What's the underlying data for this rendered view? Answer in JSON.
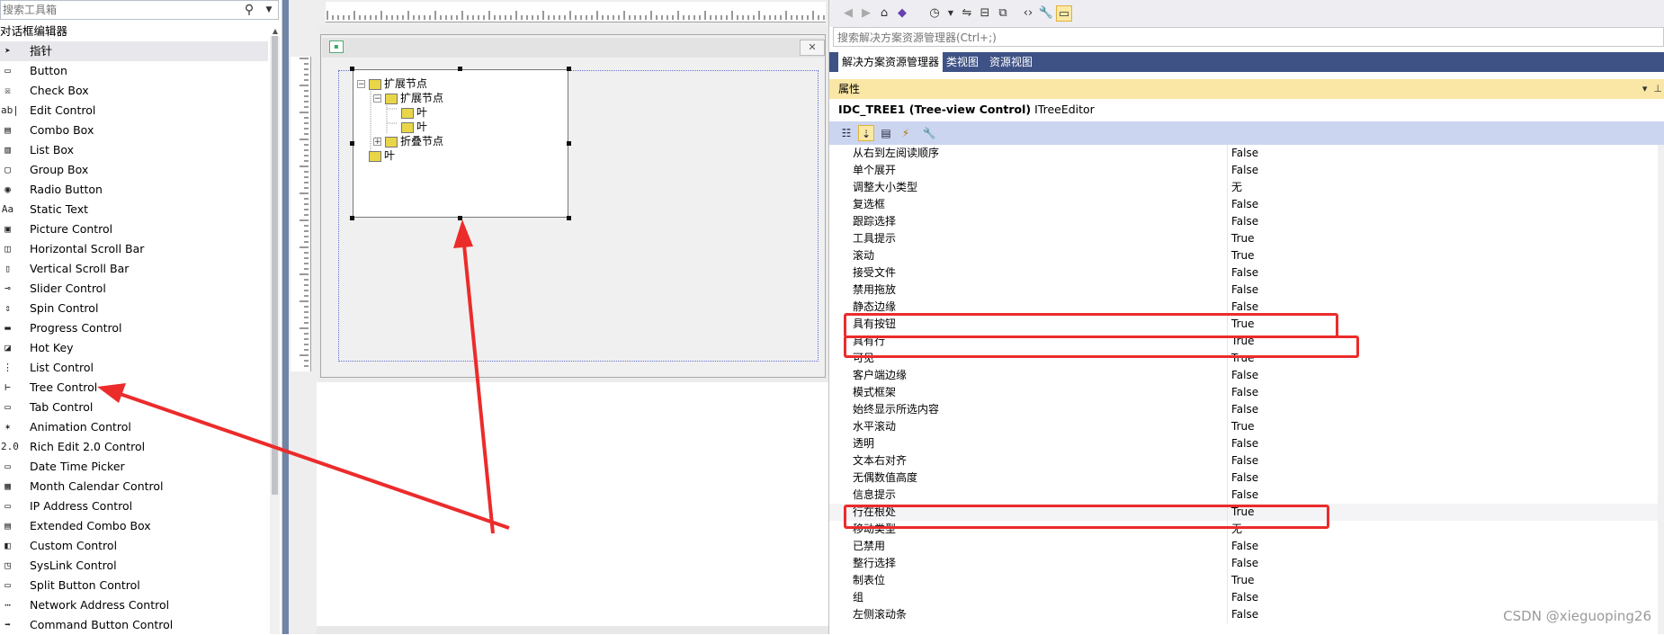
{
  "toolbox": {
    "search_placeholder": "搜索工具箱",
    "group_title": "对话框编辑器",
    "items": [
      {
        "label": "指针",
        "icon": "pointer-icon",
        "glyph": "➤",
        "selected": true
      },
      {
        "label": "Button",
        "icon": "button-icon",
        "glyph": "▭"
      },
      {
        "label": "Check Box",
        "icon": "checkbox-icon",
        "glyph": "☒"
      },
      {
        "label": "Edit Control",
        "icon": "edit-control-icon",
        "glyph": "ab|"
      },
      {
        "label": "Combo Box",
        "icon": "combo-box-icon",
        "glyph": "▤"
      },
      {
        "label": "List Box",
        "icon": "list-box-icon",
        "glyph": "▥"
      },
      {
        "label": "Group Box",
        "icon": "group-box-icon",
        "glyph": "▢"
      },
      {
        "label": "Radio Button",
        "icon": "radio-button-icon",
        "glyph": "◉"
      },
      {
        "label": "Static Text",
        "icon": "static-text-icon",
        "glyph": "Aa"
      },
      {
        "label": "Picture Control",
        "icon": "picture-control-icon",
        "glyph": "▣"
      },
      {
        "label": "Horizontal Scroll Bar",
        "icon": "hscroll-icon",
        "glyph": "◫"
      },
      {
        "label": "Vertical Scroll Bar",
        "icon": "vscroll-icon",
        "glyph": "▯"
      },
      {
        "label": "Slider Control",
        "icon": "slider-icon",
        "glyph": "⊸"
      },
      {
        "label": "Spin Control",
        "icon": "spin-control-icon",
        "glyph": "⇕"
      },
      {
        "label": "Progress Control",
        "icon": "progress-icon",
        "glyph": "▬"
      },
      {
        "label": "Hot Key",
        "icon": "hot-key-icon",
        "glyph": "◪"
      },
      {
        "label": "List Control",
        "icon": "list-control-icon",
        "glyph": "⋮"
      },
      {
        "label": "Tree Control",
        "icon": "tree-control-icon",
        "glyph": "⊢"
      },
      {
        "label": "Tab Control",
        "icon": "tab-control-icon",
        "glyph": "▭"
      },
      {
        "label": "Animation Control",
        "icon": "animation-icon",
        "glyph": "✶"
      },
      {
        "label": "Rich Edit 2.0 Control",
        "icon": "rich-edit-icon",
        "glyph": "2.0"
      },
      {
        "label": "Date Time Picker",
        "icon": "date-time-icon",
        "glyph": "▭"
      },
      {
        "label": "Month Calendar Control",
        "icon": "calendar-icon",
        "glyph": "▦"
      },
      {
        "label": "IP Address Control",
        "icon": "ip-address-icon",
        "glyph": "▭"
      },
      {
        "label": "Extended Combo Box",
        "icon": "ext-combo-icon",
        "glyph": "▤"
      },
      {
        "label": "Custom Control",
        "icon": "custom-control-icon",
        "glyph": "◧"
      },
      {
        "label": "SysLink Control",
        "icon": "syslink-icon",
        "glyph": "◳"
      },
      {
        "label": "Split Button Control",
        "icon": "split-button-icon",
        "glyph": "▭"
      },
      {
        "label": "Network Address Control",
        "icon": "network-address-icon",
        "glyph": "⋯"
      },
      {
        "label": "Command Button Control",
        "icon": "command-button-icon",
        "glyph": "➡"
      }
    ]
  },
  "tree_preview": {
    "nodes": [
      {
        "label": "扩展节点",
        "level": 0,
        "expander": "−"
      },
      {
        "label": "扩展节点",
        "level": 1,
        "expander": "−"
      },
      {
        "label": "叶",
        "level": 2,
        "expander": ""
      },
      {
        "label": "叶",
        "level": 2,
        "expander": ""
      },
      {
        "label": "折叠节点",
        "level": 1,
        "expander": "+"
      },
      {
        "label": "叶",
        "level": 0,
        "expander": ""
      }
    ]
  },
  "solution": {
    "search_placeholder": "搜索解决方案资源管理器(Ctrl+;)",
    "tabs": [
      "解决方案资源管理器",
      "类视图",
      "资源视图"
    ],
    "active_tab": 0
  },
  "properties": {
    "title": "属性",
    "object_id": "IDC_TREE1 (Tree-view Control)",
    "object_type": "ITreeEditor",
    "rows": [
      {
        "name": "从右到左阅读顺序",
        "value": "False"
      },
      {
        "name": "单个展开",
        "value": "False"
      },
      {
        "name": "调整大小类型",
        "value": "无"
      },
      {
        "name": "复选框",
        "value": "False"
      },
      {
        "name": "跟踪选择",
        "value": "False"
      },
      {
        "name": "工具提示",
        "value": "True"
      },
      {
        "name": "滚动",
        "value": "True"
      },
      {
        "name": "接受文件",
        "value": "False"
      },
      {
        "name": "禁用拖放",
        "value": "False"
      },
      {
        "name": "静态边缘",
        "value": "False"
      },
      {
        "name": "具有按钮",
        "value": "True"
      },
      {
        "name": "具有行",
        "value": "True"
      },
      {
        "name": "可见",
        "value": "True"
      },
      {
        "name": "客户端边缘",
        "value": "False"
      },
      {
        "name": "模式框架",
        "value": "False"
      },
      {
        "name": "始终显示所选内容",
        "value": "False"
      },
      {
        "name": "水平滚动",
        "value": "True"
      },
      {
        "name": "透明",
        "value": "False"
      },
      {
        "name": "文本右对齐",
        "value": "False"
      },
      {
        "name": "无偶数值高度",
        "value": "False"
      },
      {
        "name": "信息提示",
        "value": "False"
      },
      {
        "name": "行在根处",
        "value": "True"
      },
      {
        "name": "移动类型",
        "value": "无"
      },
      {
        "name": "已禁用",
        "value": "False"
      },
      {
        "name": "整行选择",
        "value": "False"
      },
      {
        "name": "制表位",
        "value": "True"
      },
      {
        "name": "组",
        "value": "False"
      },
      {
        "name": "左侧滚动条",
        "value": "False"
      }
    ]
  },
  "watermark": "CSDN @xieguoping26",
  "colors": {
    "accent_red": "#ec2b2b",
    "tab_bar": "#3e5285",
    "props_header": "#fae7a6"
  }
}
